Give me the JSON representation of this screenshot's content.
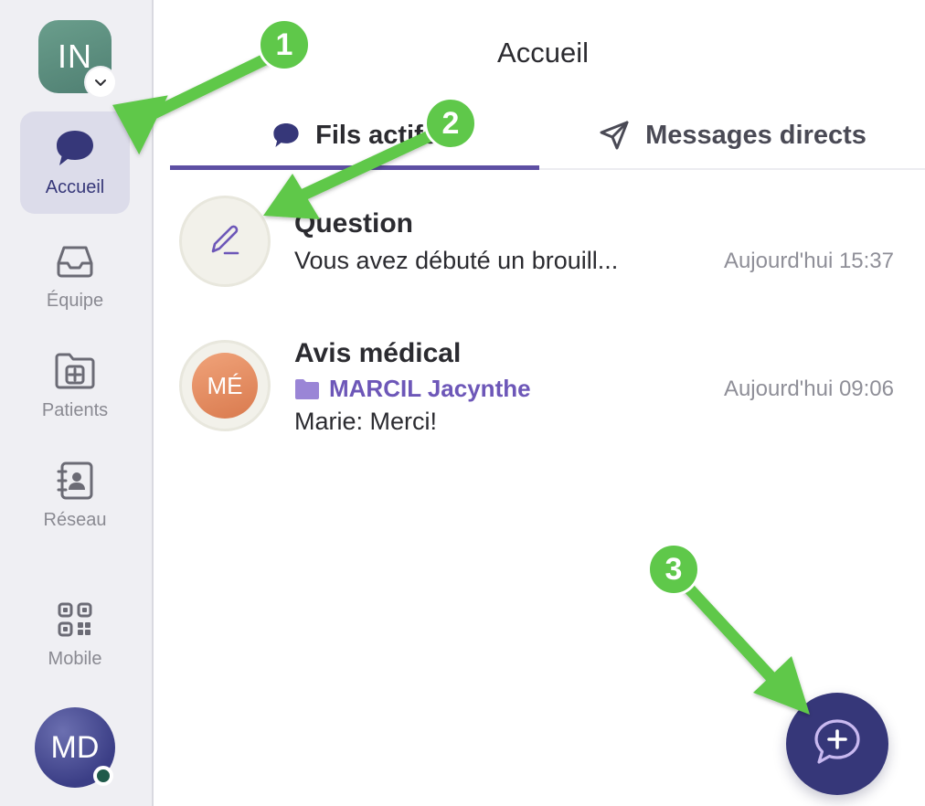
{
  "sidebar": {
    "workspace": {
      "initials": "IN",
      "chevron_icon": "chevron-down-icon"
    },
    "items": [
      {
        "key": "home",
        "label": "Accueil",
        "icon": "chat-bubble-icon",
        "active": true
      },
      {
        "key": "team",
        "label": "Équipe",
        "icon": "inbox-icon",
        "active": false
      },
      {
        "key": "patients",
        "label": "Patients",
        "icon": "folder-plus-icon",
        "active": false
      },
      {
        "key": "network",
        "label": "Réseau",
        "icon": "contact-book-icon",
        "active": false
      },
      {
        "key": "mobile",
        "label": "Mobile",
        "icon": "qr-code-icon",
        "active": false
      }
    ],
    "user": {
      "initials": "MD",
      "status": "online"
    }
  },
  "header": {
    "title": "Accueil"
  },
  "tabs": [
    {
      "label": "Fils actifs",
      "icon": "chat-bubble-icon",
      "active": true
    },
    {
      "label": "Messages directs",
      "icon": "send-icon",
      "active": false
    }
  ],
  "threads": [
    {
      "title": "Question",
      "subtitle": "Vous avez débuté un brouill...",
      "time": "Aujourd'hui 15:37",
      "avatar_icon": "pencil-icon"
    },
    {
      "title": "Avis médical",
      "folder": "MARCIL Jacynthe",
      "subtitle": "Marie: Merci!",
      "time": "Aujourd'hui 09:06",
      "avatar_initials": "MÉ"
    }
  ],
  "fab": {
    "icon": "new-chat-plus-icon"
  },
  "annotations": {
    "steps": [
      "1",
      "2",
      "3"
    ]
  },
  "colors": {
    "accent": "#363779",
    "tab_underline": "#5d4fa3",
    "folder": "#6d57b8",
    "annotation": "#5fc84a"
  }
}
